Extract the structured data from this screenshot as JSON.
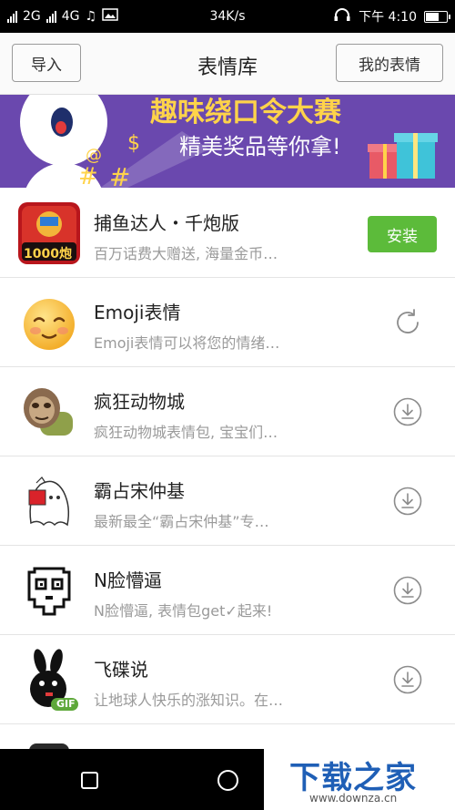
{
  "status_bar": {
    "signal_1": "2G",
    "signal_2": "4G",
    "speed": "34K/s",
    "time": "下午 4:10"
  },
  "header": {
    "import_label": "导入",
    "title": "表情库",
    "my_stickers_label": "我的表情"
  },
  "banner": {
    "headline": "趣味绕口令大赛",
    "subline": "精美奖品等你拿!"
  },
  "list": [
    {
      "title": "捕鱼达人・千炮版",
      "desc": "百万话费大赠送, 海量金币…",
      "action": "安装",
      "thumb_text": "1000炮"
    },
    {
      "title": "Emoji表情",
      "desc": "Emoji表情可以将您的情绪…",
      "action_icon": "refresh-icon"
    },
    {
      "title": "疯狂动物城",
      "desc": "疯狂动物城表情包, 宝宝们…",
      "action_icon": "download-icon"
    },
    {
      "title": "霸占宋仲基",
      "desc": "最新最全“霸占宋仲基”专…",
      "action_icon": "download-icon"
    },
    {
      "title": "N脸懵逼",
      "desc": "N脸懵逼, 表情包get✓起来!",
      "action_icon": "download-icon"
    },
    {
      "title": "飞碟说",
      "desc": "让地球人快乐的涨知识。在…",
      "action_icon": "download-icon",
      "thumb_badge": "GIF"
    }
  ],
  "watermark": {
    "text": "下载之家",
    "url": "www.downza.cn"
  },
  "colors": {
    "install_green": "#5cbb3a",
    "banner_purple": "#6b4bb0",
    "watermark_blue": "#1f5fb6"
  }
}
